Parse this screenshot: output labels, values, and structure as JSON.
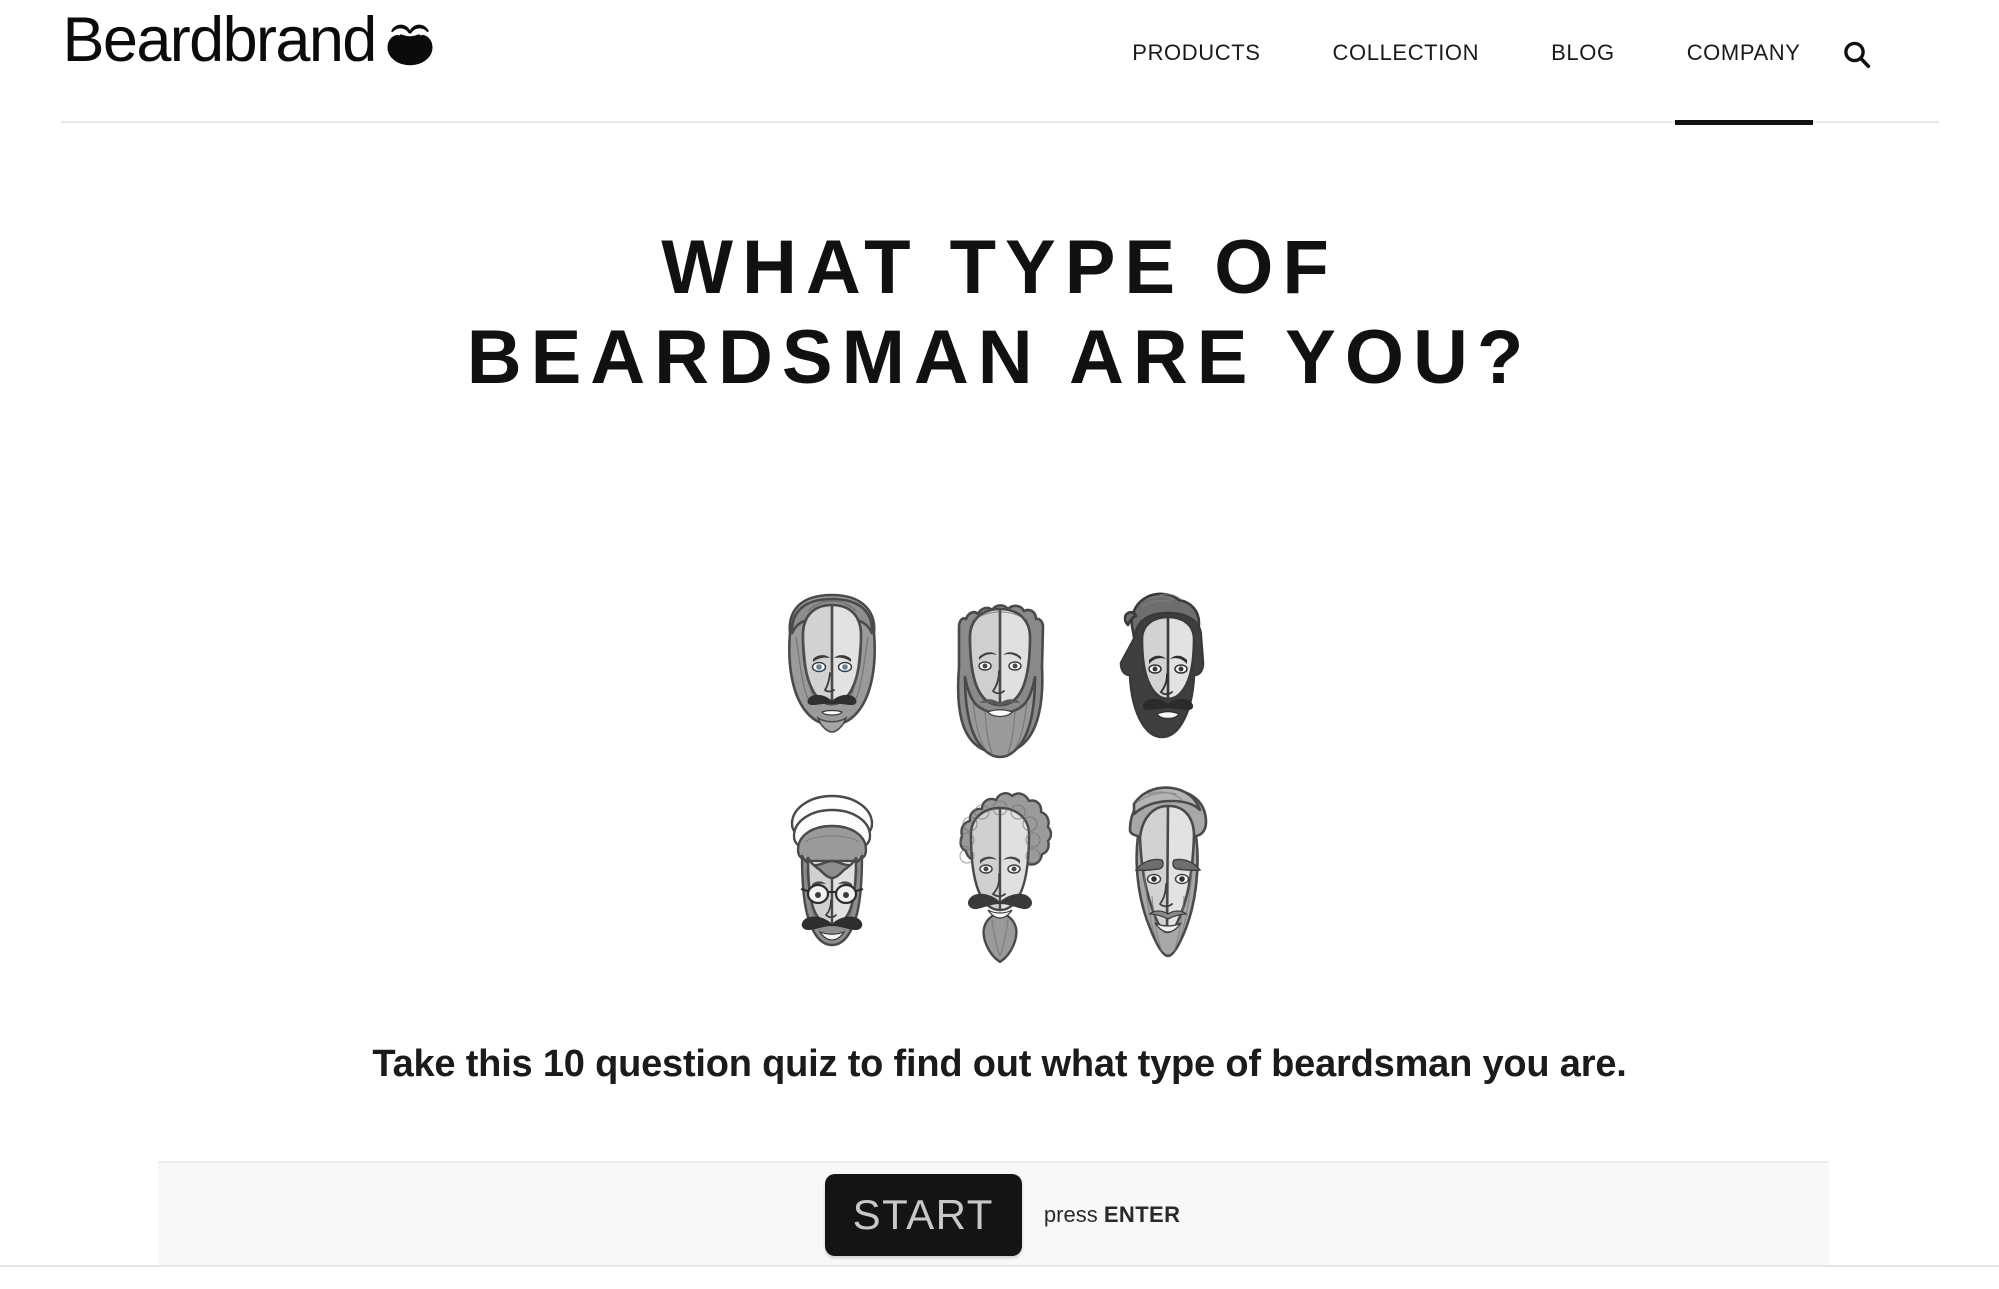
{
  "header": {
    "brand": {
      "name": "Beardbrand",
      "mark_icon": "beard-mustache-icon"
    },
    "nav": [
      {
        "label": "PRODUCTS",
        "active": false
      },
      {
        "label": "COLLECTION",
        "active": false
      },
      {
        "label": "BLOG",
        "active": false
      },
      {
        "label": "COMPANY",
        "active": true
      }
    ],
    "search": {
      "icon": "search-icon",
      "aria_label": "Search"
    }
  },
  "main": {
    "title_line1": "WHAT TYPE OF",
    "title_line2": "BEARDSMAN ARE YOU?",
    "subtitle": "Take this 10 question quiz to find out what type of beardsman you are.",
    "faces": [
      {
        "id": "face-full-beard-mustache",
        "alt": "Beardsman with full beard and curled mustache"
      },
      {
        "id": "face-long-wavy-beard",
        "alt": "Beardsman with long wavy beard"
      },
      {
        "id": "face-pompadour-dark-beard",
        "alt": "Beardsman with pompadour and dark full beard"
      },
      {
        "id": "face-beanie-glasses-handlebar",
        "alt": "Beardsman with beanie, glasses and handlebar mustache"
      },
      {
        "id": "face-curly-hair-goatee",
        "alt": "Beardsman with curly hair, handlebar mustache and goatee"
      },
      {
        "id": "face-long-pointed-beard",
        "alt": "Beardsman with swept hair and long pointed beard"
      }
    ]
  },
  "action_bar": {
    "start_label": "START",
    "hint_prefix": "press ",
    "hint_key": "ENTER"
  },
  "colors": {
    "background": "#ffffff",
    "text": "#111111",
    "accent_underline": "#111111",
    "button_bg": "#141414",
    "button_text": "#c8c8c8",
    "bar_bg": "#f8f8f8",
    "rule": "#e9e9e9"
  }
}
